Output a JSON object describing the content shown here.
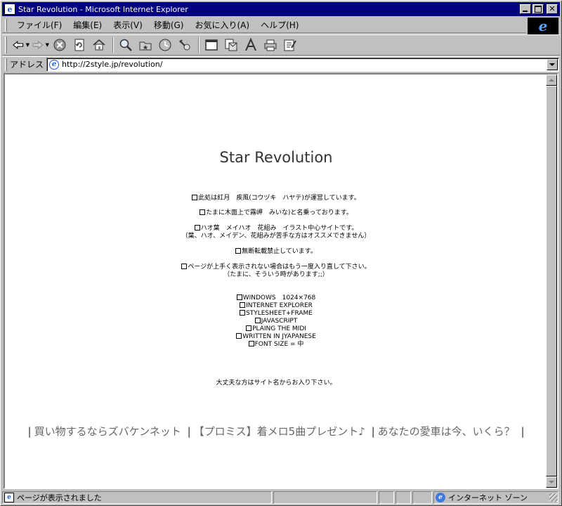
{
  "window": {
    "title": "Star Revolution - Microsoft Internet Explorer"
  },
  "menu": {
    "items": [
      "ファイル(F)",
      "編集(E)",
      "表示(V)",
      "移動(G)",
      "お気に入り(A)",
      "ヘルプ(H)"
    ]
  },
  "toolbar": {
    "buttons": [
      "back-icon",
      "forward-icon",
      "stop-icon",
      "refresh-icon",
      "home-icon",
      "search-icon",
      "favorites-icon",
      "history-icon",
      "channels-icon",
      "fullscreen-icon",
      "mail-icon",
      "font-icon",
      "print-icon",
      "edit-icon"
    ]
  },
  "address": {
    "label": "アドレス",
    "url": "http://2style.jp/revolution/"
  },
  "page": {
    "title": "Star Revolution",
    "lines": [
      "此処は紅月　疾風(コウヅキ　ハヤテ)が運営しています。",
      "たまに木面上で霧岬　みいな)と名乗っております。",
      "ハオ葉　メイハオ　花組み　イラスト中心サイトです。",
      "（葉、ハオ、メイデン、花組みが苦手な方はオススメできません）",
      "無断転載禁止しています。",
      "ページが上手く表示されない場合はもう一度入り直して下さい。",
      "（たまに、そういう時があります;;）"
    ],
    "specs": [
      "WINDOWS　1024×768",
      "INTERNET EXPLORER",
      "STYLESHEET+FRAME",
      "JAVASCRIPT",
      "PLAING THE MIDI",
      "WRITTEN IN JYAPANESE",
      "FONT SIZE = 中"
    ],
    "enter_note": "大丈夫な方はサイト名からお入り下さい。",
    "ads": [
      "買い物するならズバケンネット",
      "【プロミス】着メロ5曲プレゼント♪",
      "あなたの愛車は今、いくら？"
    ]
  },
  "status": {
    "text": "ページが表示されました",
    "zone": "インターネット ゾーン"
  },
  "colors": {
    "titlebar": "#000080",
    "chrome": "#c0c0c0",
    "page_background": "#ffffff"
  }
}
